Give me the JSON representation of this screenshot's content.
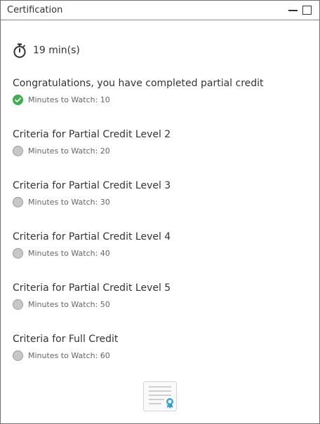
{
  "window": {
    "title": "Certification"
  },
  "duration": {
    "icon": "stopwatch-icon",
    "text": "19 min(s)"
  },
  "items": [
    {
      "title": "Congratulations, you have completed partial credit",
      "label": "Minutes to Watch: 10",
      "status": "completed",
      "status_color": "#3fae4f"
    },
    {
      "title": "Criteria for Partial Credit Level 2",
      "label": "Minutes to Watch: 20",
      "status": "pending",
      "status_color": "#c7c7c7"
    },
    {
      "title": "Criteria for Partial Credit Level 3",
      "label": "Minutes to Watch: 30",
      "status": "pending",
      "status_color": "#c7c7c7"
    },
    {
      "title": "Criteria for Partial Credit Level 4",
      "label": "Minutes to Watch: 40",
      "status": "pending",
      "status_color": "#c7c7c7"
    },
    {
      "title": "Criteria for Partial Credit Level 5",
      "label": "Minutes to Watch: 50",
      "status": "pending",
      "status_color": "#c7c7c7"
    },
    {
      "title": "Criteria for Full Credit",
      "label": "Minutes to Watch: 60",
      "status": "pending",
      "status_color": "#c7c7c7"
    }
  ],
  "certificate": {
    "icon": "certificate-icon",
    "accent_color": "#3aa7d8"
  }
}
